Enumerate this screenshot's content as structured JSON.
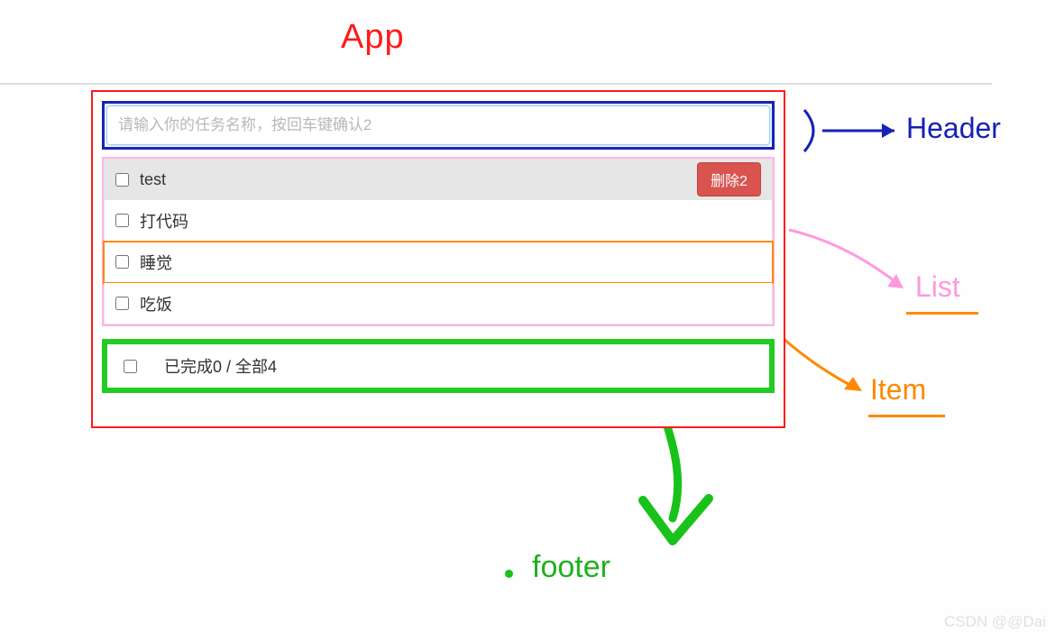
{
  "annotations": {
    "app": "App",
    "header": "Header",
    "list": "List",
    "item": "Item",
    "footer": "footer"
  },
  "header": {
    "input_placeholder": "请输入你的任务名称，按回车键确认2"
  },
  "list": {
    "items": [
      {
        "label": "test",
        "checked": false,
        "hovered": true,
        "delete_label": "删除2",
        "show_delete": true,
        "highlight": false
      },
      {
        "label": "打代码",
        "checked": false,
        "hovered": false,
        "show_delete": false,
        "highlight": false
      },
      {
        "label": "睡觉",
        "checked": false,
        "hovered": false,
        "show_delete": false,
        "highlight": true
      },
      {
        "label": "吃饭",
        "checked": false,
        "hovered": false,
        "show_delete": false,
        "highlight": false
      }
    ]
  },
  "footer": {
    "summary_prefix": "已完成",
    "done_count": 0,
    "separator": " / ",
    "total_prefix": "全部",
    "total_count": 4
  },
  "watermark": "CSDN @@Dai",
  "colors": {
    "app_border": "#ff1a1a",
    "header_border": "#1720b7",
    "list_border": "#ffb5e6",
    "item_highlight": "#ff8800",
    "footer_border": "#22cc22",
    "delete_btn": "#d9534f"
  }
}
